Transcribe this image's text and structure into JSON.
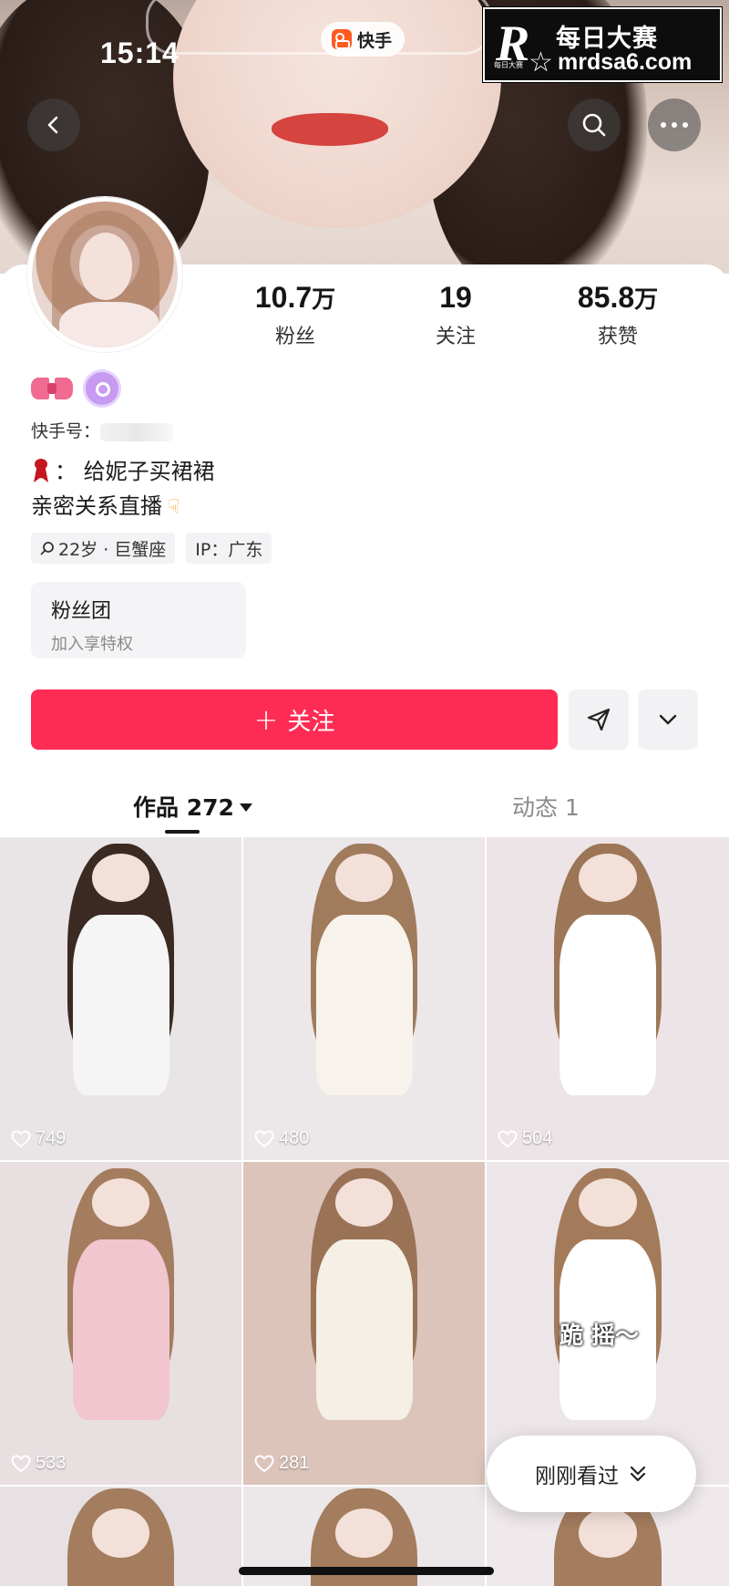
{
  "status_bar": {
    "time": "15:14",
    "app_name": "快手"
  },
  "watermark": {
    "logo_letter": "R",
    "brand": "每日大赛",
    "url": "mrdsa6.com",
    "logo_small": "每日大赛"
  },
  "nav": {
    "back_icon": "chevron-left-icon",
    "search_icon": "search-icon",
    "more_icon": "more-dots-icon"
  },
  "profile": {
    "stats": [
      {
        "number": "10.7",
        "unit": "万",
        "label": "粉丝"
      },
      {
        "number": "19",
        "unit": "",
        "label": "关注"
      },
      {
        "number": "85.8",
        "unit": "万",
        "label": "获赞"
      }
    ],
    "kuaishou_id_label": "快手号：",
    "bio_line1": "：  给妮子买裙裙",
    "bio_line2": "亲密关系直播",
    "tags": [
      {
        "text": "22岁 · 巨蟹座"
      },
      {
        "text": "IP：广东"
      }
    ],
    "fans_club": {
      "title": "粉丝团",
      "subtitle": "加入享特权"
    },
    "follow_label": "关注"
  },
  "tabs": {
    "works_label": "作品",
    "works_count": "272",
    "dynamic_label": "动态",
    "dynamic_count": "1"
  },
  "grid": [
    {
      "likes": "749",
      "bg": "#e9e5e7",
      "hair": "#3b2a22",
      "body": "#f5f5f5"
    },
    {
      "likes": "480",
      "bg": "#ece7e8",
      "hair": "#a07b5c",
      "body": "#f7f3ec"
    },
    {
      "likes": "504",
      "bg": "#ece4e7",
      "hair": "#9c7656",
      "body": "#ffffff"
    },
    {
      "likes": "533",
      "bg": "#e8dfe0",
      "hair": "#a47c5e",
      "body": "#f1c6cf"
    },
    {
      "likes": "281",
      "bg": "#dcc4bb",
      "hair": "#9a7256",
      "body": "#f5efe6"
    },
    {
      "likes": "",
      "bg": "#ece6e9",
      "hair": "#a37b5b",
      "body": "#ffffff",
      "caption": "跪 摇～"
    }
  ],
  "recent_pill": {
    "label": "刚刚看过"
  },
  "colors": {
    "accent": "#fe2c55",
    "tab_active": "#161616",
    "tab_inactive": "#8a8a8a"
  }
}
